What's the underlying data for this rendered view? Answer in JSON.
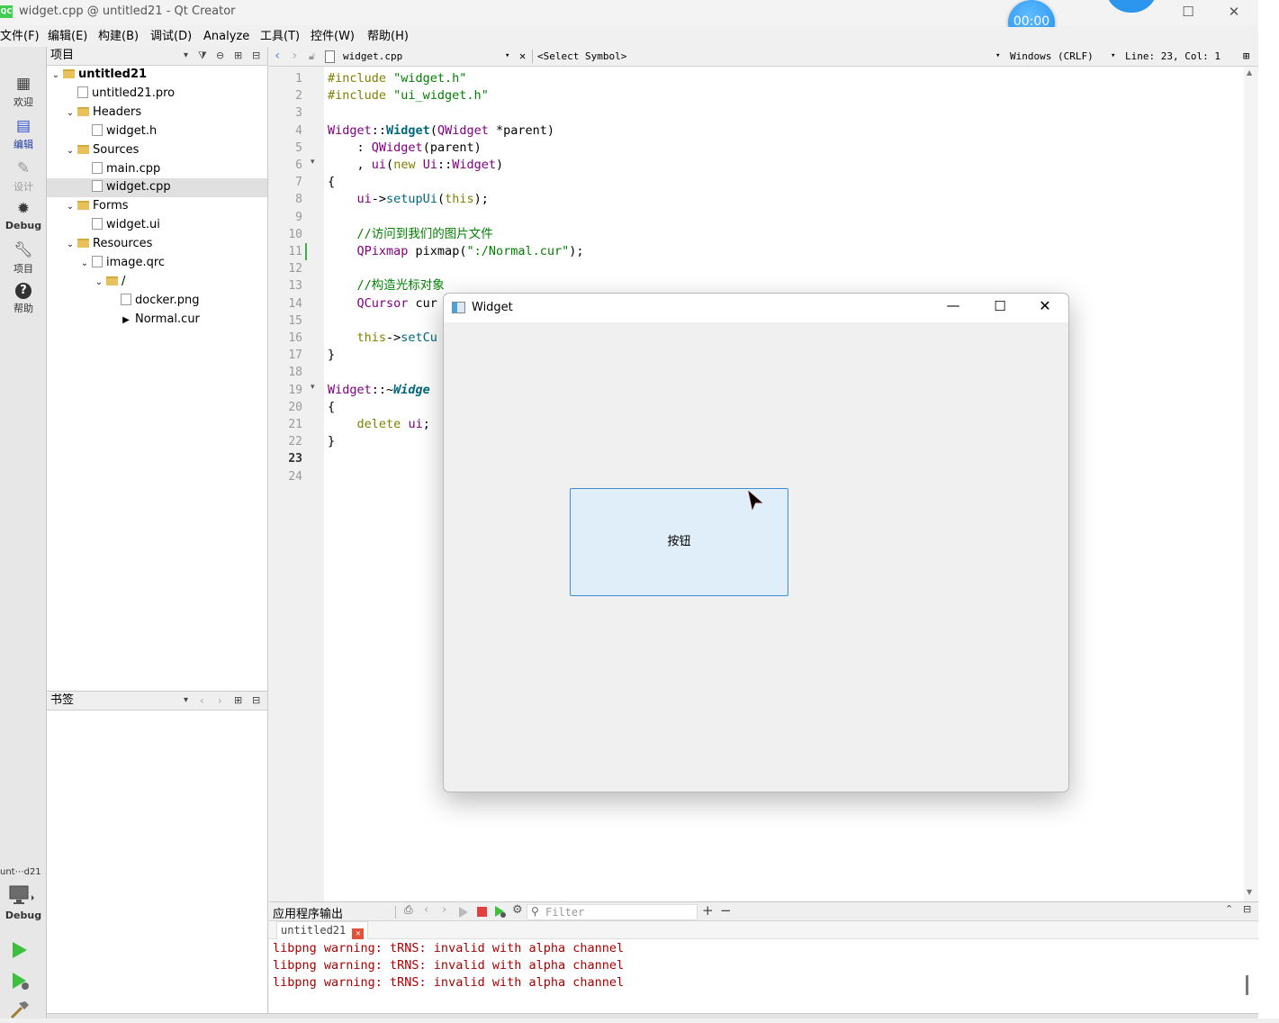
{
  "window": {
    "title": "widget.cpp @ untitled21 - Qt Creator",
    "logo": "QC"
  },
  "timer": {
    "text": "00:00"
  },
  "menu": [
    "文件(F)",
    "编辑(E)",
    "构建(B)",
    "调试(D)",
    "Analyze",
    "工具(T)",
    "控件(W)",
    "帮助(H)"
  ],
  "modes": [
    {
      "label": "欢迎",
      "icon": "grid-icon"
    },
    {
      "label": "编辑",
      "icon": "edit-doc-icon"
    },
    {
      "label": "设计",
      "icon": "pencil-icon"
    },
    {
      "label": "Debug",
      "icon": "bug-icon"
    },
    {
      "label": "项目",
      "icon": "wrench-icon"
    },
    {
      "label": "帮助",
      "icon": "help-icon"
    }
  ],
  "kit": {
    "project": "unt⋯d21",
    "mode": "Debug"
  },
  "project_pane": {
    "header": "项目",
    "tree": [
      {
        "label": "untitled21",
        "level": 0,
        "type": "project",
        "expanded": true
      },
      {
        "label": "untitled21.pro",
        "level": 1,
        "type": "file"
      },
      {
        "label": "Headers",
        "level": 1,
        "type": "folder",
        "expanded": true
      },
      {
        "label": "widget.h",
        "level": 2,
        "type": "file"
      },
      {
        "label": "Sources",
        "level": 1,
        "type": "folder",
        "expanded": true
      },
      {
        "label": "main.cpp",
        "level": 2,
        "type": "file"
      },
      {
        "label": "widget.cpp",
        "level": 2,
        "type": "file",
        "selected": true
      },
      {
        "label": "Forms",
        "level": 1,
        "type": "folder",
        "expanded": true
      },
      {
        "label": "widget.ui",
        "level": 2,
        "type": "file"
      },
      {
        "label": "Resources",
        "level": 1,
        "type": "folder",
        "expanded": true
      },
      {
        "label": "image.qrc",
        "level": 2,
        "type": "file",
        "expanded": true
      },
      {
        "label": "/",
        "level": 3,
        "type": "folder",
        "expanded": true
      },
      {
        "label": "docker.png",
        "level": 4,
        "type": "file"
      },
      {
        "label": "Normal.cur",
        "level": 4,
        "type": "cursor"
      }
    ]
  },
  "bookmarks_pane": {
    "header": "书签"
  },
  "editor": {
    "file": "widget.cpp",
    "symbol": "<Select Symbol>",
    "line_ending": "Windows (CRLF)",
    "position": "Line: 23, Col: 1",
    "current_line": 23,
    "line_numbers": [
      "1",
      "2",
      "3",
      "4",
      "5",
      "6",
      "7",
      "8",
      "9",
      "10",
      "11",
      "12",
      "13",
      "14",
      "15",
      "16",
      "17",
      "18",
      "19",
      "20",
      "21",
      "22",
      "23",
      "24"
    ],
    "lines": [
      {
        "parts": [
          {
            "t": "#include ",
            "c": "kw"
          },
          {
            "t": "\"widget.h\"",
            "c": "str"
          }
        ]
      },
      {
        "parts": [
          {
            "t": "#include ",
            "c": "kw"
          },
          {
            "t": "\"ui_widget.h\"",
            "c": "str"
          }
        ]
      },
      {
        "parts": []
      },
      {
        "parts": [
          {
            "t": "Widget",
            "c": "cls"
          },
          {
            "t": "::"
          },
          {
            "t": "Widget",
            "c": "fn bold"
          },
          {
            "t": "("
          },
          {
            "t": "QWidget",
            "c": "cls"
          },
          {
            "t": " *parent)"
          }
        ]
      },
      {
        "parts": [
          {
            "t": "    : "
          },
          {
            "t": "QWidget",
            "c": "cls"
          },
          {
            "t": "(parent)"
          }
        ]
      },
      {
        "parts": [
          {
            "t": "    , "
          },
          {
            "t": "ui",
            "c": "cls"
          },
          {
            "t": "("
          },
          {
            "t": "new",
            "c": "kw"
          },
          {
            "t": " "
          },
          {
            "t": "Ui",
            "c": "cls"
          },
          {
            "t": "::"
          },
          {
            "t": "Widget",
            "c": "cls"
          },
          {
            "t": ")"
          }
        ]
      },
      {
        "parts": [
          {
            "t": "{"
          }
        ]
      },
      {
        "parts": [
          {
            "t": "    "
          },
          {
            "t": "ui",
            "c": "cls"
          },
          {
            "t": "->"
          },
          {
            "t": "setupUi",
            "c": "fn"
          },
          {
            "t": "("
          },
          {
            "t": "this",
            "c": "kw"
          },
          {
            "t": ");"
          }
        ]
      },
      {
        "parts": []
      },
      {
        "parts": [
          {
            "t": "    //访问到我们的图片文件",
            "c": "cm"
          }
        ]
      },
      {
        "parts": [
          {
            "t": "    "
          },
          {
            "t": "QPixmap",
            "c": "cls"
          },
          {
            "t": " pixmap("
          },
          {
            "t": "\":/Normal.cur\"",
            "c": "str"
          },
          {
            "t": ");"
          }
        ]
      },
      {
        "parts": []
      },
      {
        "parts": [
          {
            "t": "    //构造光标对象",
            "c": "cm"
          }
        ]
      },
      {
        "parts": [
          {
            "t": "    "
          },
          {
            "t": "QCursor",
            "c": "cls"
          },
          {
            "t": " cur"
          }
        ]
      },
      {
        "parts": []
      },
      {
        "parts": [
          {
            "t": "    "
          },
          {
            "t": "this",
            "c": "kw"
          },
          {
            "t": "->"
          },
          {
            "t": "setCu",
            "c": "fn"
          }
        ]
      },
      {
        "parts": [
          {
            "t": "}"
          }
        ]
      },
      {
        "parts": []
      },
      {
        "parts": [
          {
            "t": "Widget",
            "c": "cls"
          },
          {
            "t": "::~"
          },
          {
            "t": "Widge",
            "c": "fn bold it"
          }
        ]
      },
      {
        "parts": [
          {
            "t": "{"
          }
        ]
      },
      {
        "parts": [
          {
            "t": "    "
          },
          {
            "t": "delete",
            "c": "kw"
          },
          {
            "t": " "
          },
          {
            "t": "ui",
            "c": "cls"
          },
          {
            "t": ";"
          }
        ]
      },
      {
        "parts": [
          {
            "t": "}"
          }
        ]
      },
      {
        "parts": []
      },
      {
        "parts": []
      }
    ]
  },
  "output": {
    "header": "应用程序输出",
    "filter_placeholder": "Filter",
    "tab": "untitled21",
    "lines": [
      "libpng warning: tRNS: invalid with alpha channel",
      "libpng warning: tRNS: invalid with alpha channel",
      "libpng warning: tRNS: invalid with alpha channel"
    ]
  },
  "app_window": {
    "title": "Widget",
    "button_label": "按钮"
  }
}
